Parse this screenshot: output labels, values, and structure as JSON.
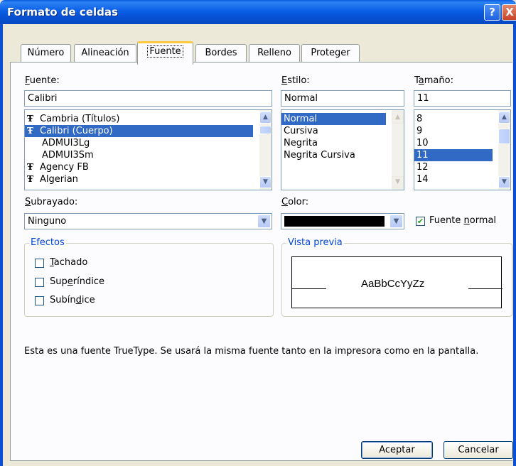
{
  "window": {
    "title": "Formato de celdas",
    "help": "?",
    "close": "X"
  },
  "tabs": [
    {
      "label": "Número"
    },
    {
      "label": "Alineación"
    },
    {
      "label": "Fuente"
    },
    {
      "label": "Bordes"
    },
    {
      "label": "Relleno"
    },
    {
      "label": "Proteger"
    }
  ],
  "font": {
    "label_first": "F",
    "label_rest": "uente:",
    "value": "Calibri",
    "items": [
      {
        "label": "Cambria (Títulos)",
        "icon": "truetype-icon"
      },
      {
        "label": "Calibri (Cuerpo)",
        "icon": "truetype-icon",
        "selected": true
      },
      {
        "label": "ADMUI3Lg",
        "icon": ""
      },
      {
        "label": "ADMUI3Sm",
        "icon": ""
      },
      {
        "label": "Agency FB",
        "icon": "truetype-icon"
      },
      {
        "label": "Algerian",
        "icon": "truetype-icon"
      }
    ]
  },
  "style": {
    "label_first": "E",
    "label_rest": "stilo:",
    "value": "Normal",
    "items": [
      "Normal",
      "Cursiva",
      "Negrita",
      "Negrita Cursiva"
    ]
  },
  "size": {
    "label_pre": "T",
    "label_u": "a",
    "label_post": "maño:",
    "value": "11",
    "items": [
      "8",
      "9",
      "10",
      "11",
      "12",
      "14"
    ]
  },
  "underline": {
    "label_first": "S",
    "label_rest": "ubrayado:",
    "value": "Ninguno"
  },
  "color": {
    "label_first": "C",
    "label_rest": "olor:",
    "swatch": "#000000"
  },
  "normal_font": {
    "label_pre": "Fuente ",
    "label_u": "n",
    "label_post": "ormal",
    "checked": true,
    "check_glyph": "✔"
  },
  "effects": {
    "title": "Efectos",
    "items": [
      {
        "pre": "",
        "u": "T",
        "post": "achado"
      },
      {
        "pre": "Sup",
        "u": "e",
        "post": "ríndice"
      },
      {
        "pre": "Subín",
        "u": "d",
        "post": "ice"
      }
    ]
  },
  "preview": {
    "title": "Vista previa",
    "sample": "AaBbCcYyZz"
  },
  "info": "Esta es una fuente TrueType. Se usará la misma fuente tanto en la impresora como en la pantalla.",
  "buttons": {
    "ok": "Aceptar",
    "cancel": "Cancelar"
  },
  "colors": {
    "titlebar": "#0a5fe6",
    "selection": "#316ac5",
    "tab_highlight": "#ffc83c",
    "group_title": "#0046d5"
  }
}
